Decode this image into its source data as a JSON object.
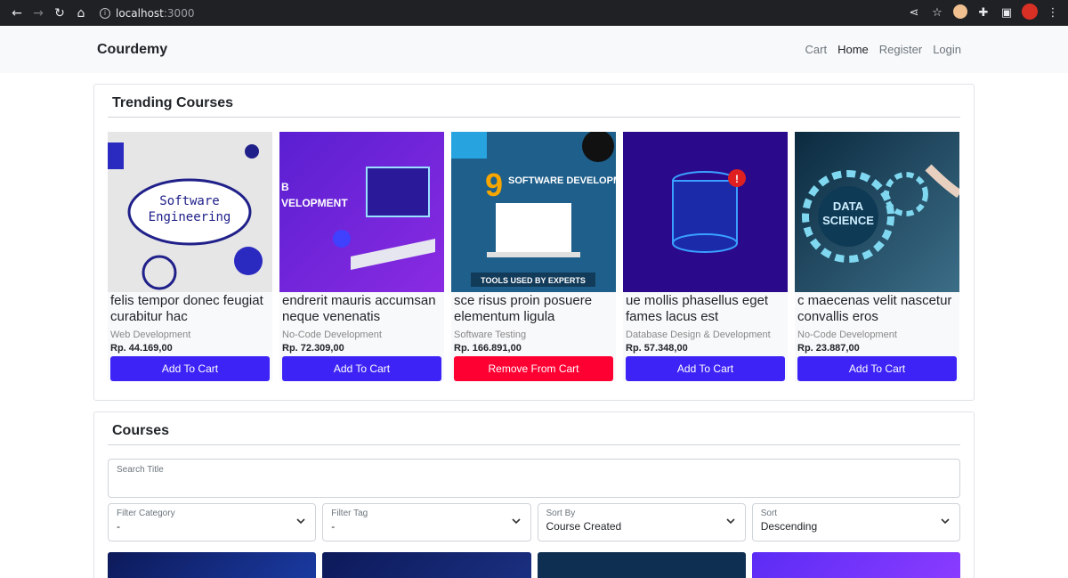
{
  "browser": {
    "host": "localhost",
    "port": ":3000"
  },
  "navbar": {
    "brand": "Courdemy",
    "links": [
      {
        "label": "Cart",
        "active": false
      },
      {
        "label": "Home",
        "active": true
      },
      {
        "label": "Register",
        "active": false
      },
      {
        "label": "Login",
        "active": false
      }
    ]
  },
  "trending": {
    "title": "Trending Courses",
    "courses": [
      {
        "name": "felis tempor donec feugiat curabitur hac",
        "category": "Web Development",
        "price": "Rp. 44.169,00",
        "button": "Add To Cart",
        "thumb_text_1": "Software",
        "thumb_text_2": "Engineering"
      },
      {
        "name": "endrerit mauris accumsan neque venenatis",
        "category": "No-Code Development",
        "price": "Rp. 72.309,00",
        "button": "Add To Cart",
        "thumb_text_1": "B",
        "thumb_text_2": "VELOPMENT"
      },
      {
        "name": "sce risus proin posuere elementum ligula",
        "category": "Software Testing",
        "price": "Rp. 166.891,00",
        "button": "Remove From Cart",
        "thumb_text_1": "SOFTWARE DEVELOPMENT",
        "thumb_text_2": "TOOLS USED BY EXPERTS"
      },
      {
        "name": "ue mollis phasellus eget fames lacus est",
        "category": "Database Design & Development",
        "price": "Rp. 57.348,00",
        "button": "Add To Cart"
      },
      {
        "name": "c maecenas velit nascetur convallis eros",
        "category": "No-Code Development",
        "price": "Rp. 23.887,00",
        "button": "Add To Cart",
        "thumb_text_1": "DATA",
        "thumb_text_2": "SCIENCE"
      }
    ]
  },
  "courses": {
    "title": "Courses",
    "search": {
      "label": "Search Title",
      "value": ""
    },
    "filters": [
      {
        "label": "Filter Category",
        "value": "-"
      },
      {
        "label": "Filter Tag",
        "value": "-"
      },
      {
        "label": "Sort By",
        "value": "Course Created"
      },
      {
        "label": "Sort",
        "value": "Descending"
      }
    ]
  },
  "colors": {
    "primary": "#3d23f5",
    "danger": "#ff0033"
  }
}
